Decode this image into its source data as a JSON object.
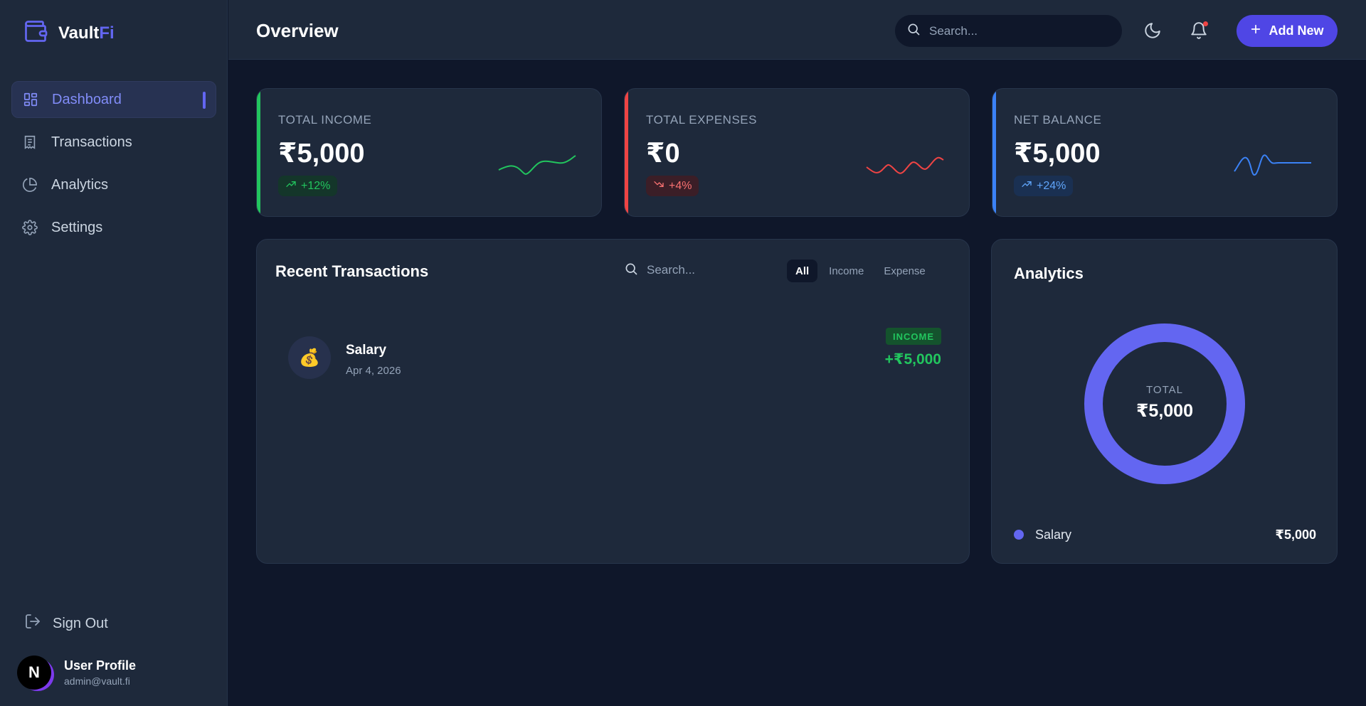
{
  "brand": {
    "name": "Vault",
    "accent": "Fi"
  },
  "sidebar": {
    "items": [
      {
        "label": "Dashboard",
        "icon": "grid-icon",
        "active": true
      },
      {
        "label": "Transactions",
        "icon": "receipt-icon",
        "active": false
      },
      {
        "label": "Analytics",
        "icon": "pie-chart-icon",
        "active": false
      },
      {
        "label": "Settings",
        "icon": "gear-icon",
        "active": false
      }
    ],
    "sign_out": "Sign Out",
    "profile": {
      "initial": "N",
      "name": "User Profile",
      "email": "admin@vault.fi"
    }
  },
  "header": {
    "title": "Overview",
    "search_placeholder": "Search...",
    "add_label": "Add New"
  },
  "stats": [
    {
      "label": "TOTAL INCOME",
      "value": "₹5,000",
      "change": "+12%",
      "trend": "up",
      "color": "#22c55e"
    },
    {
      "label": "TOTAL EXPENSES",
      "value": "₹0",
      "change": "+4%",
      "trend": "down",
      "color": "#ef4444"
    },
    {
      "label": "NET BALANCE",
      "value": "₹5,000",
      "change": "+24%",
      "trend": "up",
      "color": "#3b82f6"
    }
  ],
  "transactions": {
    "title": "Recent Transactions",
    "search_placeholder": "Search...",
    "filters": [
      "All",
      "Income",
      "Expense"
    ],
    "active_filter": "All",
    "rows": [
      {
        "icon": "💰",
        "name": "Salary",
        "date": "Apr 4, 2026",
        "type": "INCOME",
        "amount": "+₹5,000"
      }
    ]
  },
  "analytics": {
    "title": "Analytics",
    "total_label": "TOTAL",
    "total_value": "₹5,000",
    "legend": [
      {
        "label": "Salary",
        "value": "₹5,000",
        "color": "#6366f1"
      }
    ]
  },
  "chart_data": {
    "type": "pie",
    "categories": [
      "Salary"
    ],
    "values": [
      5000
    ]
  }
}
